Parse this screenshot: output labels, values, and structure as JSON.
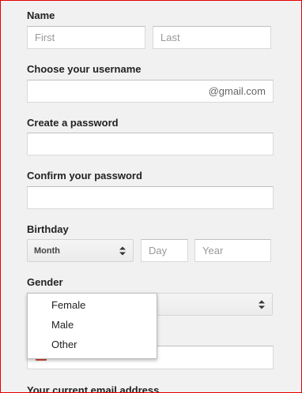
{
  "name_section": {
    "label": "Name",
    "first_placeholder": "First",
    "last_placeholder": "Last"
  },
  "username_section": {
    "label": "Choose your username",
    "domain_suffix": "@gmail.com"
  },
  "password_section": {
    "label": "Create a password"
  },
  "confirm_section": {
    "label": "Confirm your password"
  },
  "birthday_section": {
    "label": "Birthday",
    "month_value": "Month",
    "day_placeholder": "Day",
    "year_placeholder": "Year"
  },
  "gender_section": {
    "label": "Gender",
    "options": [
      "Female",
      "Male",
      "Other"
    ]
  },
  "email_section": {
    "label": "Your current email address"
  },
  "colors": {
    "frame_border": "#e60000",
    "background": "#f1f1f1",
    "error_mark": "#d14836"
  }
}
